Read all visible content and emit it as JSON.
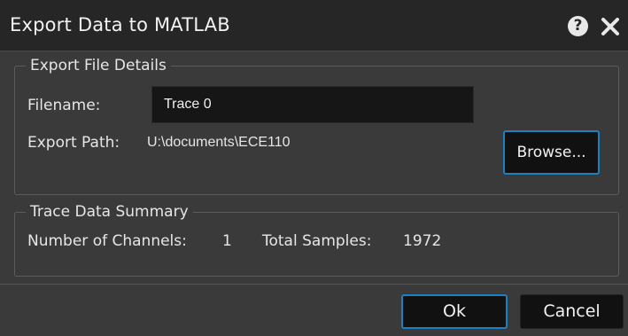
{
  "dialog": {
    "title": "Export Data to MATLAB",
    "help_icon": "help-icon",
    "close_icon": "close-icon"
  },
  "export_details": {
    "legend": "Export File Details",
    "filename_label": "Filename:",
    "filename_value": "Trace 0",
    "path_label": "Export Path:",
    "path_value": "U:\\documents\\ECE110",
    "browse_label": "Browse..."
  },
  "summary": {
    "legend": "Trace Data Summary",
    "channels_label": "Number of Channels:",
    "channels_value": "1",
    "samples_label": "Total Samples:",
    "samples_value": "1972"
  },
  "footer": {
    "ok_label": "Ok",
    "cancel_label": "Cancel"
  },
  "colors": {
    "accent": "#1f7fc2",
    "titlebar": "#262626",
    "background": "#3a3a3a"
  }
}
